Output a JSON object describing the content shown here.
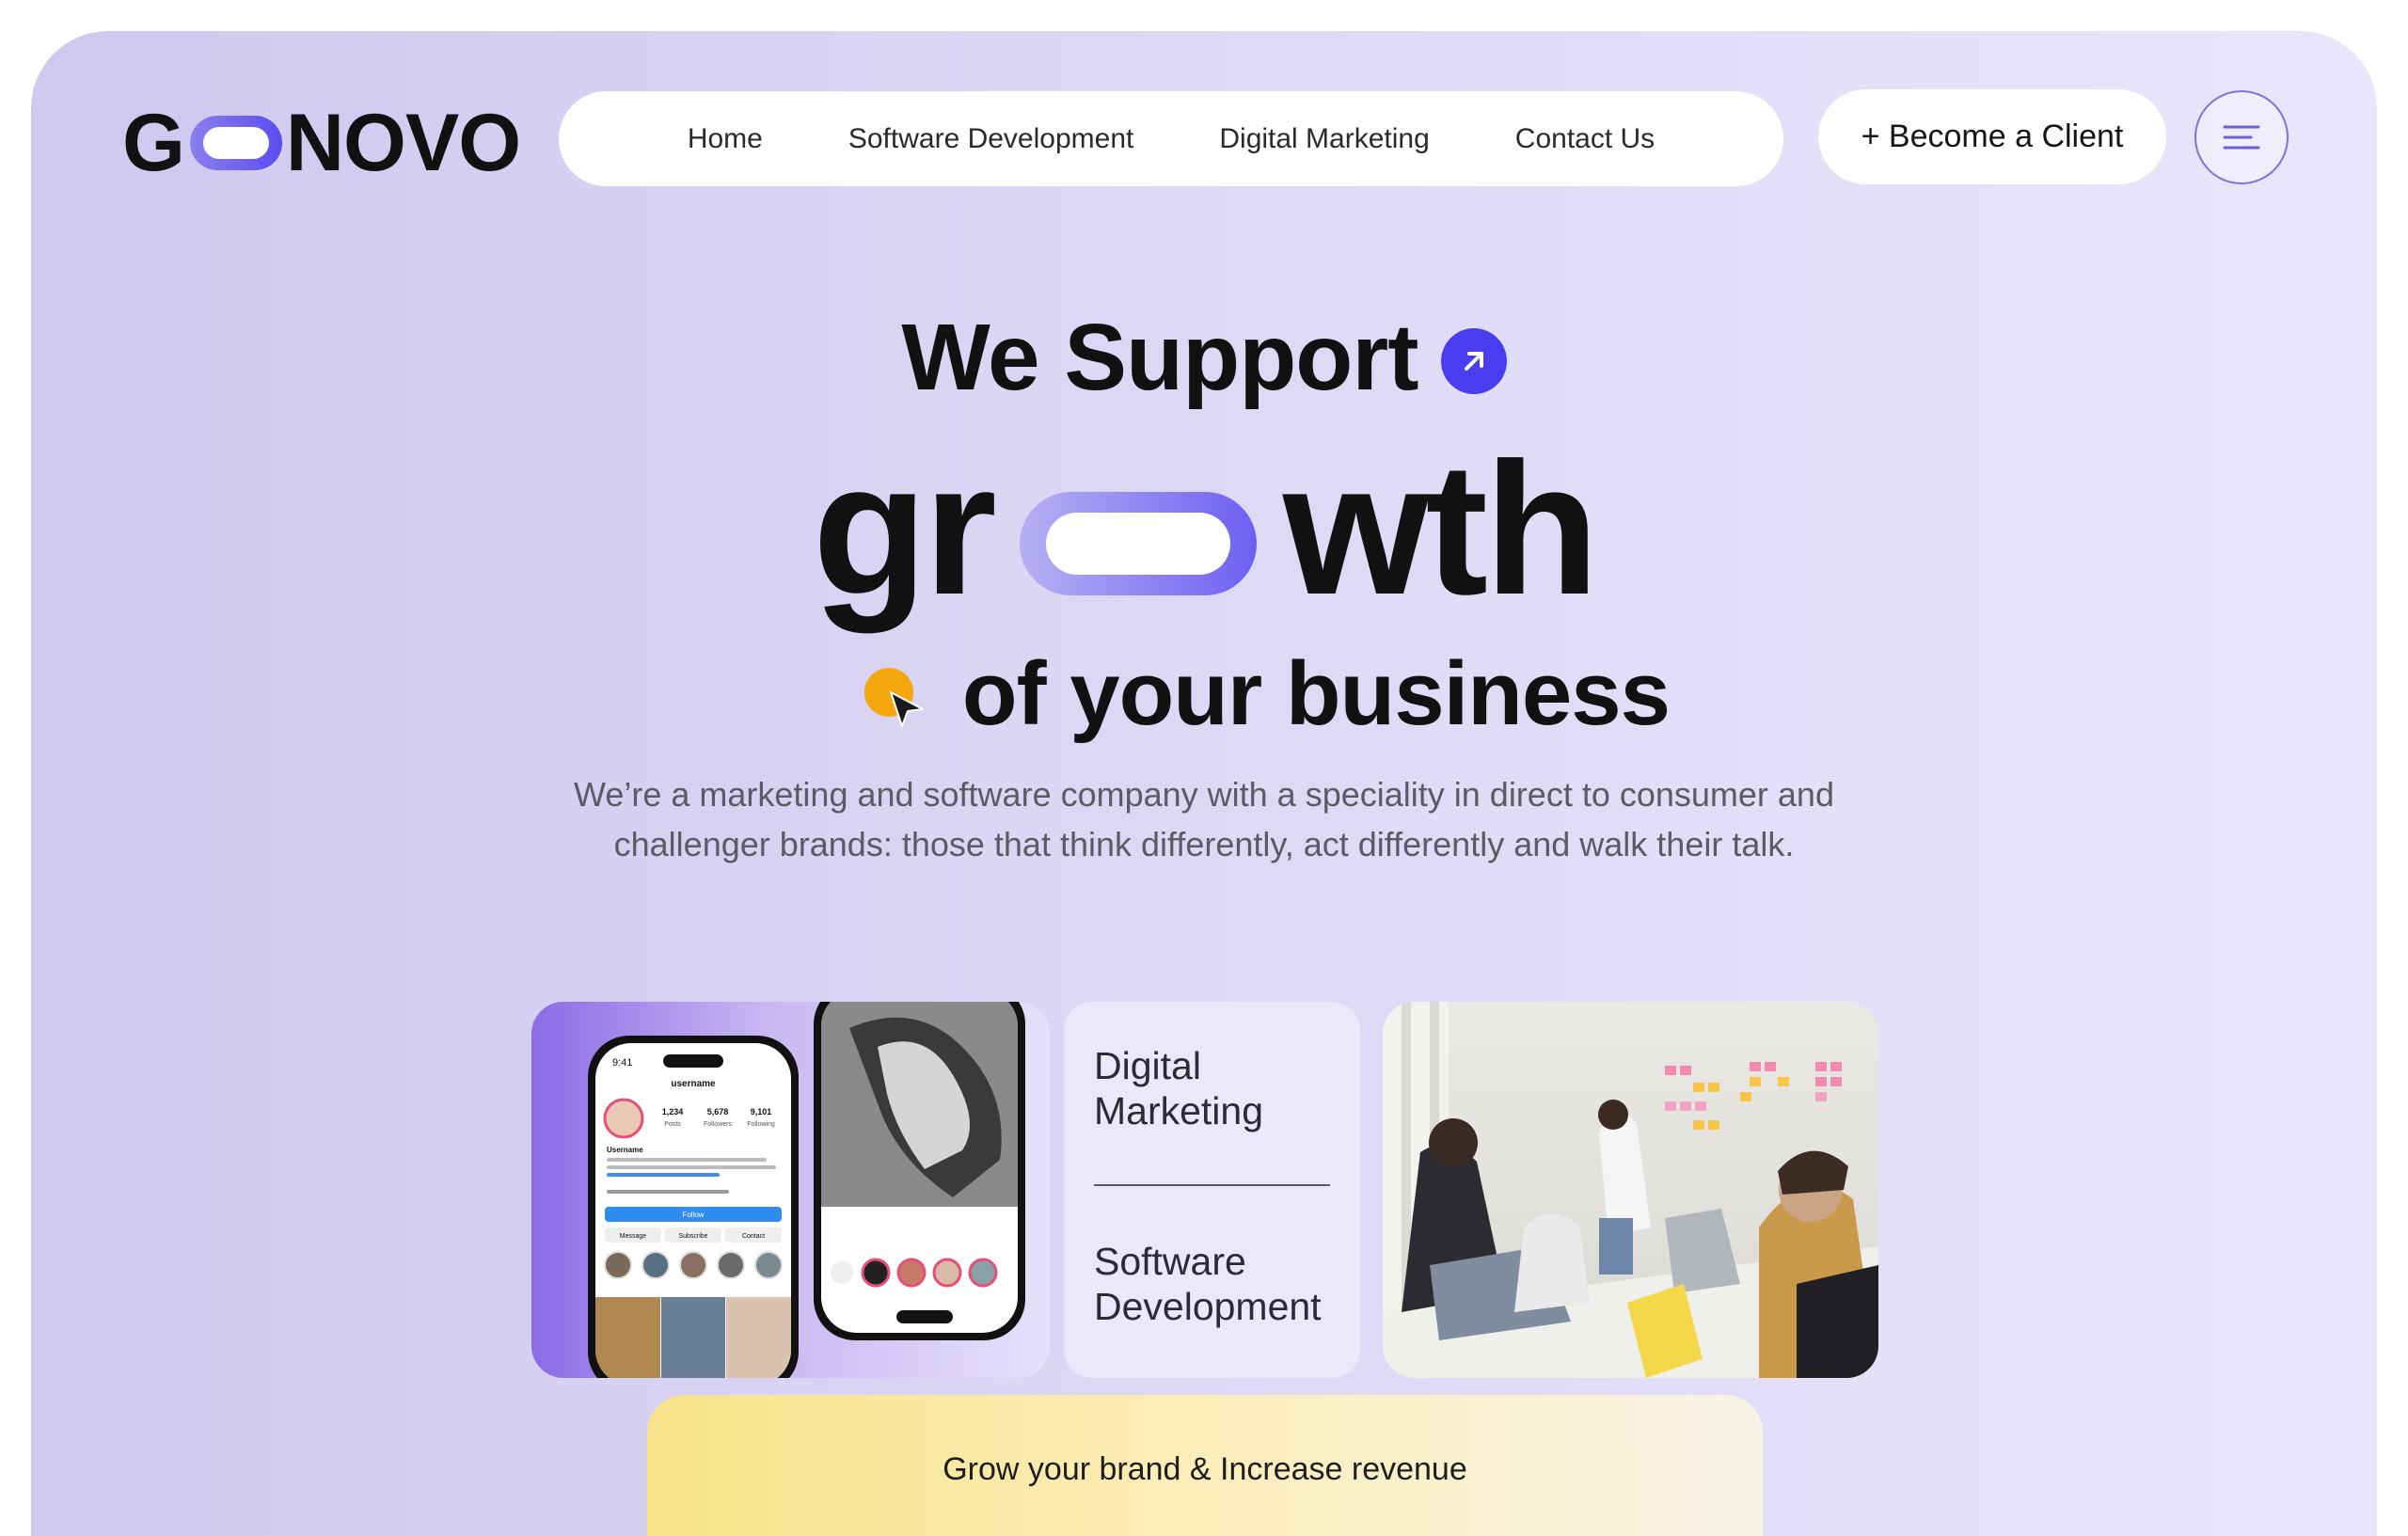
{
  "brand": {
    "logo_left": "G",
    "logo_right": "NOVO"
  },
  "nav": {
    "items": [
      {
        "label": "Home"
      },
      {
        "label": "Software Development"
      },
      {
        "label": "Digital Marketing"
      },
      {
        "label": "Contact Us"
      }
    ]
  },
  "header": {
    "client_button": "+ Become a Client",
    "menu_icon": "hamburger-icon"
  },
  "hero": {
    "line1": "We Support",
    "line2_left": "gr",
    "line2_right": "wth",
    "line3": "of your business",
    "subtitle_line1": "We’re a marketing and software company with a speciality in direct to consumer and",
    "subtitle_line2": "challenger brands: those that think differently, act differently and walk their talk."
  },
  "services": {
    "item1": "Digital Marketing",
    "item2": "Software Development"
  },
  "phone_mock": {
    "time": "9:41",
    "username": "username",
    "posts": "1,234",
    "posts_label": "Posts",
    "followers": "5,678",
    "followers_label": "Followers",
    "following": "9,101",
    "following_label": "Following",
    "name": "Username",
    "follow_button": "Follow",
    "message": "Message",
    "subscribe": "Subscribe",
    "contact": "Contact"
  },
  "banner": {
    "text": "Grow your brand & Increase revenue"
  },
  "colors": {
    "accent": "#4a3df0",
    "pill_gradient_end": "#6f5ff2",
    "orange": "#f5a70f"
  }
}
